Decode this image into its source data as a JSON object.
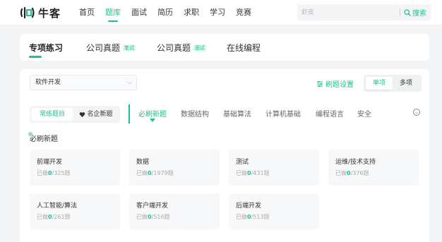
{
  "brand": {
    "name": "牛客"
  },
  "nav": [
    {
      "label": "首页"
    },
    {
      "label": "题库"
    },
    {
      "label": "面试"
    },
    {
      "label": "简历"
    },
    {
      "label": "求职"
    },
    {
      "label": "学习"
    },
    {
      "label": "竞赛"
    }
  ],
  "search": {
    "placeholder": "虾皮",
    "button": "搜索"
  },
  "tabs": [
    {
      "label": "专项练习",
      "tag": ""
    },
    {
      "label": "公司真题",
      "tag": "笔试"
    },
    {
      "label": "公司真题",
      "tag": "面试"
    },
    {
      "label": "在线编程",
      "tag": ""
    }
  ],
  "filter": {
    "selected": "软件开发"
  },
  "settings": {
    "label": "刷题设置"
  },
  "modes": [
    {
      "label": "单项"
    },
    {
      "label": "多项"
    }
  ],
  "sources": [
    {
      "label": "常练题目"
    },
    {
      "label": "名企新题"
    }
  ],
  "categories": [
    {
      "label": "必刷新题"
    },
    {
      "label": "数据结构"
    },
    {
      "label": "基础算法"
    },
    {
      "label": "计算机基础"
    },
    {
      "label": "编程语言"
    },
    {
      "label": "安全"
    }
  ],
  "section": {
    "title": "必刷新题"
  },
  "cards": [
    {
      "title": "前端开发",
      "done_prefix": "已做",
      "done": "0",
      "total": "/325题"
    },
    {
      "title": "数据",
      "done_prefix": "已做",
      "done": "0",
      "total": "/1979题"
    },
    {
      "title": "测试",
      "done_prefix": "已做",
      "done": "0",
      "total": "/431题"
    },
    {
      "title": "运维/技术支持",
      "done_prefix": "已做",
      "done": "0",
      "total": "/376题"
    },
    {
      "title": "人工智能/算法",
      "done_prefix": "已做",
      "done": "0",
      "total": "/261题"
    },
    {
      "title": "客户端开发",
      "done_prefix": "已做",
      "done": "0",
      "total": "/516题"
    },
    {
      "title": "后端开发",
      "done_prefix": "已做",
      "done": "0",
      "total": "/513题"
    }
  ],
  "colors": {
    "accent": "#1fbf8f",
    "background": "#f3f4f6",
    "card": "#f7f8fa"
  }
}
